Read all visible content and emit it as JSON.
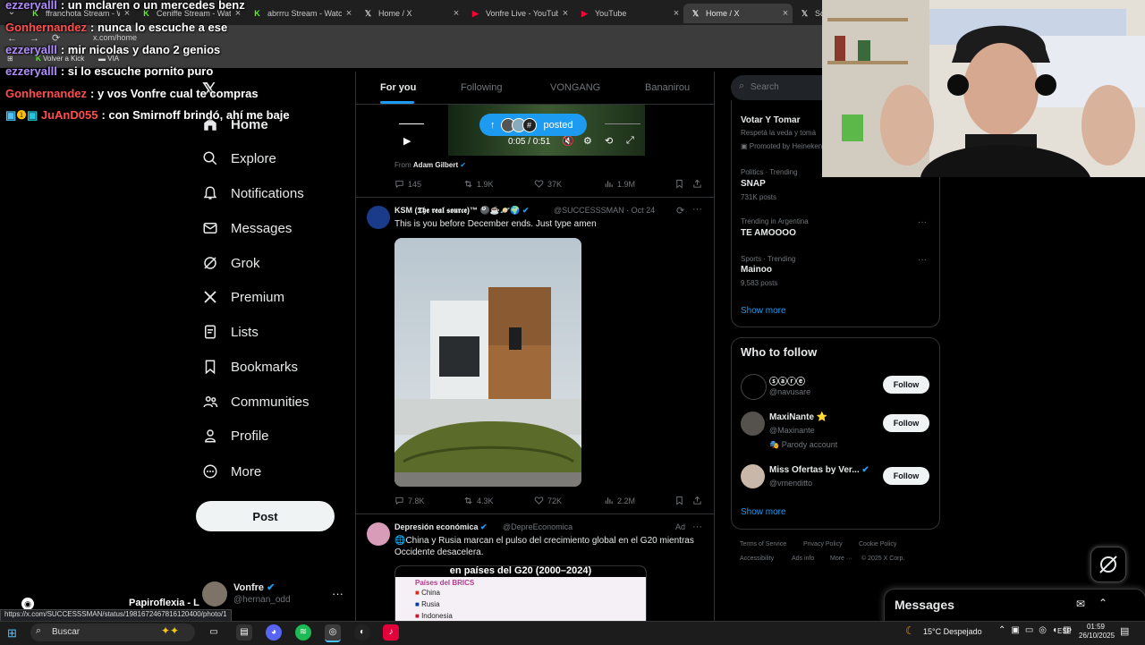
{
  "browser": {
    "tabs": [
      {
        "label": "ffranchota Stream - W",
        "icon": "kick-icon",
        "color": "#53fc18"
      },
      {
        "label": "Ceniffe Stream - Watc",
        "icon": "kick-icon",
        "color": "#53fc18"
      },
      {
        "label": "abrrru Stream - Watc",
        "icon": "kick-icon",
        "color": "#53fc18"
      },
      {
        "label": "Home / X",
        "icon": "x-icon",
        "color": "#ffffff"
      },
      {
        "label": "Vonfre Live - YouTub",
        "icon": "youtube-icon",
        "color": "#ff0033"
      },
      {
        "label": "YouTube",
        "icon": "youtube-icon",
        "color": "#ff0033"
      },
      {
        "label": "Home / X",
        "icon": "x-icon",
        "color": "#ffffff"
      },
      {
        "label": "So",
        "icon": "x-icon",
        "color": "#ffffff"
      }
    ],
    "url": "x.com/home",
    "bookmarks": [
      "Volver a Kick",
      "VIA"
    ]
  },
  "chat": [
    {
      "user": "ezzeryalll",
      "text": ": un mclaren o un mercedes benz",
      "color": "#b08cff"
    },
    {
      "user": "Gonhernandez",
      "text": ": nunca lo escuche a ese",
      "color": "#ff4d4d"
    },
    {
      "user": "ezzeryalll",
      "text": ": mir nicolas y dano 2 genios",
      "color": "#b08cff"
    },
    {
      "user": "ezzeryalll",
      "text": ": si lo escuche pornito puro",
      "color": "#b08cff"
    },
    {
      "user": "Gonhernandez",
      "text": ": y vos Vonfre cual te compras",
      "color": "#ff4d4d"
    },
    {
      "user": "JuAnD055",
      "text": ": con Smirnoff brindó, ahí me baje",
      "color": "#ff4d4d"
    }
  ],
  "nav": {
    "items": [
      "Home",
      "Explore",
      "Notifications",
      "Messages",
      "Grok",
      "Premium",
      "Lists",
      "Bookmarks",
      "Communities",
      "Profile",
      "More"
    ],
    "post_label": "Post",
    "profile": {
      "name": "Vonfre",
      "handle": "@hernan_odd"
    }
  },
  "feed": {
    "tabs": [
      "For you",
      "Following",
      "VONGANG",
      "Bananirou"
    ],
    "video_post": {
      "posted_label": "posted",
      "time": "0:05 / 0:51",
      "from_prefix": "From",
      "from_name": "Adam Gilbert",
      "stats": {
        "replies": "145",
        "reposts": "1.9K",
        "likes": "37K",
        "views": "1.9M"
      }
    },
    "tweet": {
      "name": "KSM (𝕿𝖍𝖊 𝖗𝖊𝖆𝖑 𝖘𝖔𝖚𝖗𝖈𝖊)™",
      "handle": "@SUCCESSSMAN",
      "date": "· Oct 24",
      "text": "This is you before December ends. Just type amen",
      "stats": {
        "replies": "7.8K",
        "reposts": "4.3K",
        "likes": "72K",
        "views": "2.2M"
      }
    },
    "ad": {
      "name": "Depresión económica",
      "handle": "@DepreEconomica",
      "ad_label": "Ad",
      "text": "🌐China y Rusia marcan el pulso del crecimiento global en el G20 mientras Occidente desacelera.",
      "image_title": "en países del G20 (2000–2024)",
      "image_subtitle": "Países del BRICS",
      "countries": [
        "China",
        "Rusia",
        "Indonesia"
      ]
    }
  },
  "right": {
    "search_placeholder": "Search",
    "trends": [
      {
        "category": "",
        "name": "Votar Y Tomar",
        "count": "Respetá la veda y tomá",
        "promo": "Promoted by Heineken"
      },
      {
        "category": "Politics · Trending",
        "name": "SNAP",
        "count": "731K posts"
      },
      {
        "category": "Trending in Argentina",
        "name": "TE AMOOOO",
        "count": ""
      },
      {
        "category": "Sports · Trending",
        "name": "Mainoo",
        "count": "9,583 posts"
      }
    ],
    "show_more": "Show more",
    "who_to_follow": {
      "title": "Who to follow",
      "follow_label": "Follow",
      "accounts": [
        {
          "name": "ⓢⓐⓡⓔ",
          "handle": "@navusare",
          "note": ""
        },
        {
          "name": "MaxiNante ⭐",
          "handle": "@Maxinante",
          "note": "Parody account"
        },
        {
          "name": "Miss Ofertas by Ver...",
          "handle": "@vmenditto",
          "note": ""
        }
      ],
      "show_more": "Show more"
    },
    "footer": [
      "Terms of Service",
      "Privacy Policy",
      "Cookie Policy",
      "Accessibility",
      "Ads info",
      "More ···",
      "© 2025 X Corp."
    ],
    "messages_title": "Messages"
  },
  "overlay": {
    "status_url": "https://x.com/SUCCESSSMAN/status/1981672467816120400/photo/1",
    "stream_title": "Papiroflexia - L"
  },
  "taskbar": {
    "search_label": "Buscar",
    "weather": "15°C  Despejado",
    "lang": "ESP",
    "time": "01:59",
    "date": "26/10/2025"
  },
  "colors": {
    "accent": "#1d9bf0",
    "bg": "#000000",
    "border": "#2f3336",
    "muted": "#71767b"
  }
}
